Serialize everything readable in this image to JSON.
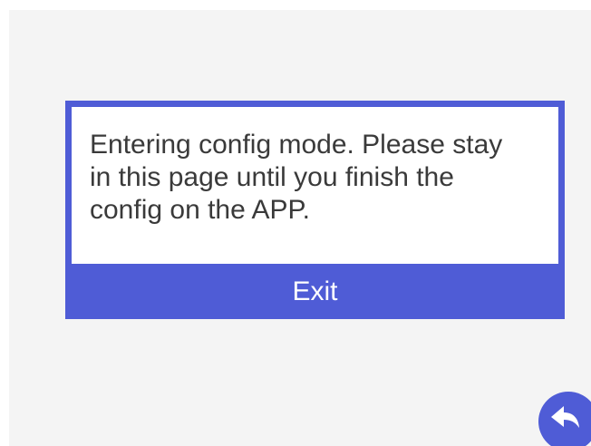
{
  "dialog": {
    "message": "Entering config mode. Please stay\nin this page until you finish the\nconfig on the APP.",
    "exit_label": "Exit"
  },
  "navigation": {
    "back_icon": "back-arrow-icon"
  },
  "colors": {
    "accent": "#4f5cd6",
    "background": "#f4f4f4",
    "text": "#3a3a3a"
  }
}
